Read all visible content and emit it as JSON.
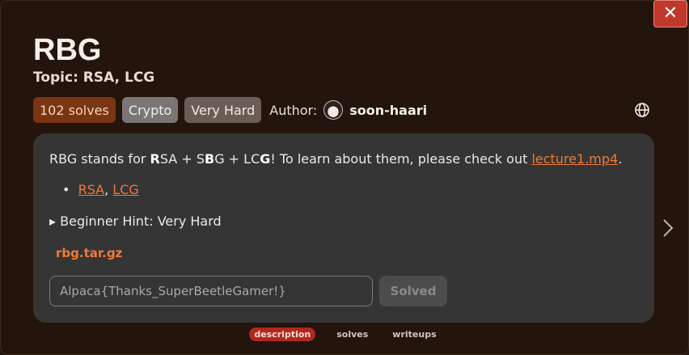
{
  "challenge": {
    "title": "RBG",
    "topic": "Topic: RSA, LCG",
    "solves": "102 solves",
    "category": "Crypto",
    "difficulty": "Very Hard",
    "author_label": "Author:",
    "author_name": "soon-haari"
  },
  "description": {
    "intro_before": "RBG stands for ",
    "r": "R",
    "sa": "SA + S",
    "b": "B",
    "glcg": "G + LC",
    "g": "G",
    "intro_after": "! To learn about them, please check out ",
    "lecture_link": "lecture1.mp4",
    "period": ".",
    "bullet_rsa": "RSA",
    "bullet_sep": ", ",
    "bullet_lcg": "LCG",
    "hint": "▸ Beginner Hint: Very Hard",
    "file": "rbg.tar.gz"
  },
  "flag_form": {
    "placeholder": "Alpaca{Thanks_SuperBeetleGamer!}",
    "submit_label": "Solved"
  },
  "tabs": [
    "description",
    "solves",
    "writeups"
  ],
  "close_label": "✕",
  "colors": {
    "accent": "#f0793a",
    "close": "#c0392b",
    "active_tab": "#b0281f"
  },
  "icons": [
    "close-icon",
    "globe-icon",
    "chevron-right-icon"
  ]
}
